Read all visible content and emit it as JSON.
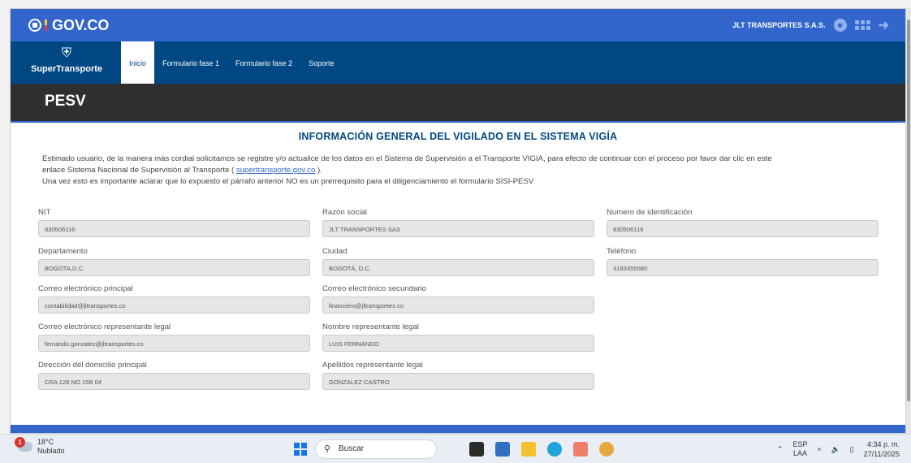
{
  "gov_header": {
    "logo_text": "GOV.CO",
    "company": "JLT TRANSPORTES S.A.S.",
    "user_icon": "user-icon",
    "apps_icon": "apps-grid-icon",
    "logout_icon": "logout-icon"
  },
  "nav": {
    "brand": "SuperTransporte",
    "tabs": [
      {
        "label": "Inicio",
        "active": true
      },
      {
        "label": "Formulario fase 1",
        "active": false
      },
      {
        "label": "Formulario fase 2",
        "active": false
      },
      {
        "label": "Soporte",
        "active": false
      }
    ]
  },
  "page_title": "PESV",
  "section_title": "INFORMACIÓN GENERAL DEL VIGILADO EN EL SISTEMA VIGÍA",
  "intro": {
    "line1": "Estimado usuario, de la manera más cordial solicitamos se registre y/o actualice de los datos en el Sistema de Supervisión a el Transporte VIGIA, para efecto de continuar con el proceso por favor dar clic en este",
    "line2_prefix": "enlace Sistema Nacional de Supervisión al Transporte ( ",
    "link": "supertransporte.gov.co",
    "line2_suffix": " ).",
    "line3": "Una vez esto es importante aclarar que lo expuesto el párrafo anterior NO es un prerrequisito para el diligenciamiento el formulario SISI-PESV"
  },
  "fields": {
    "nit": {
      "label": "NIT",
      "value": "830506116"
    },
    "razon_social": {
      "label": "Razón social",
      "value": "JLT TRANSPORTES SAS"
    },
    "numero_id": {
      "label": "Numero de identificación",
      "value": "830506116"
    },
    "departamento": {
      "label": "Departamento",
      "value": "BOGOTA,D.C."
    },
    "ciudad": {
      "label": "Ciudad",
      "value": "BOGOTÁ, D.C."
    },
    "telefono": {
      "label": "Teléfono",
      "value": "3183355580"
    },
    "correo_principal": {
      "label": "Correo electrónico principal",
      "value": "contabilidad@jltransportes.co"
    },
    "correo_secundario": {
      "label": "Correo electrónico secundario",
      "value": "financiero@jltransportes.co"
    },
    "correo_representante": {
      "label": "Correo electrónico representante legal",
      "value": "fernando.gonzalez@jltransportes.co"
    },
    "nombre_representante": {
      "label": "Nombre representante legal",
      "value": "LUIS FERNANDO"
    },
    "direccion": {
      "label": "Dirección del domicilio principal",
      "value": "CRA 128 NO 15B 04"
    },
    "apellidos_representante": {
      "label": "Apellidos representante legal",
      "value": "GONZALEZ CASTRO"
    }
  },
  "taskbar": {
    "weather_temp": "18°C",
    "weather_desc": "Nublado",
    "weather_badge": "1",
    "search_placeholder": "Buscar",
    "lang_top": "ESP",
    "lang_bottom": "LAA",
    "time": "4:34 p. m.",
    "date": "27/11/2025"
  },
  "colors": {
    "gov_blue": "#3366cc",
    "nav_blue": "#004884",
    "title_dark": "#2f2f2f"
  }
}
